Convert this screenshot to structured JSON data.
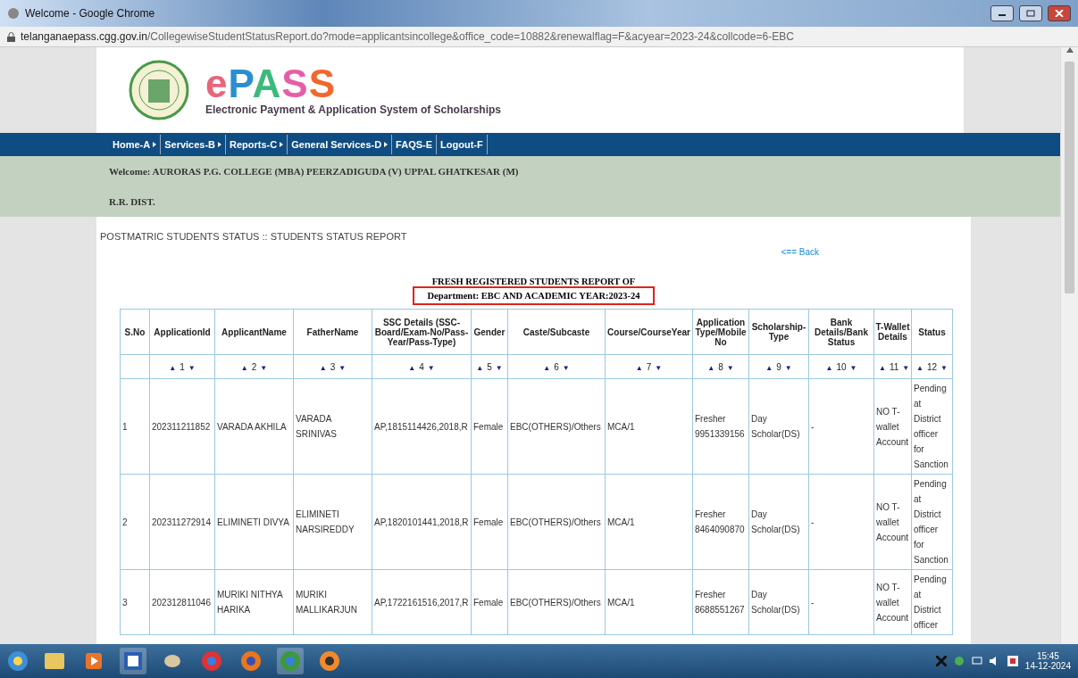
{
  "window": {
    "title": "Welcome - Google Chrome"
  },
  "address_bar": {
    "host": "telanganaepass.cgg.gov.in",
    "path": "/CollegewiseStudentStatusReport.do?mode=applicantsincollege&office_code=10882&renewalflag=F&acyear=2023-24&collcode=6-EBC"
  },
  "header": {
    "logo_text": "ePASS",
    "subtitle": "Electronic Payment & Application System of Scholarships"
  },
  "nav": [
    {
      "label": "Home-A",
      "arrow": true
    },
    {
      "label": "Services-B",
      "arrow": true
    },
    {
      "label": "Reports-C",
      "arrow": true
    },
    {
      "label": "General Services-D",
      "arrow": true
    },
    {
      "label": "FAQS-E",
      "arrow": false
    },
    {
      "label": "Logout-F",
      "arrow": false
    }
  ],
  "welcome": {
    "line1": "Welcome: AURORAS P.G. COLLEGE (MBA) PEERZADIGUDA (V) UPPAL GHATKESAR (M)",
    "line2": "R.R. DIST."
  },
  "page_heading": "POSTMATRIC STUDENTS STATUS :: STUDENTS STATUS REPORT",
  "back_link": "<== Back",
  "report_title": "FRESH REGISTERED STUDENTS REPORT OF",
  "report_subtitle": "Department: EBC AND ACADEMIC YEAR:2023-24",
  "table": {
    "columns": [
      "S.No",
      "ApplicationId",
      "ApplicantName",
      "FatherName",
      "SSC Details (SSC-Board/Exam-No/Pass-Year/Pass-Type)",
      "Gender",
      "Caste/Subcaste",
      "Course/CourseYear",
      "Application Type/Mobile No",
      "Scholarship-Type",
      "Bank Details/Bank Status",
      "T-Wallet Details",
      "Status"
    ],
    "sort_row": [
      {
        "up": "▲",
        "label": "1",
        "down": "▼"
      },
      {
        "up": "▲",
        "label": "2",
        "down": "▼"
      },
      {
        "up": "▲",
        "label": "3",
        "down": "▼"
      },
      {
        "up": "▲",
        "label": "4",
        "down": "▼"
      },
      {
        "up": "▲",
        "label": "5",
        "down": "▼"
      },
      {
        "up": "▲",
        "label": "6",
        "down": "▼"
      },
      {
        "up": "▲",
        "label": "7",
        "down": "▼"
      },
      {
        "up": "▲",
        "label": "8",
        "down": "▼"
      },
      {
        "up": "▲",
        "label": "9",
        "down": "▼"
      },
      {
        "up": "▲",
        "label": "10",
        "down": "▼"
      },
      {
        "up": "▲",
        "label": "11",
        "down": "▼"
      },
      {
        "up": "▲",
        "label": "12",
        "down": "▼"
      }
    ],
    "rows": [
      [
        "1",
        "202311211852",
        "VARADA AKHILA",
        "VARADA SRINIVAS",
        "AP,1815114426,2018,R",
        "Female",
        "EBC(OTHERS)/Others",
        "MCA/1",
        "Fresher 9951339156",
        "Day Scholar(DS)",
        "-",
        "NO T-wallet Account",
        "Pending at District officer for Sanction"
      ],
      [
        "2",
        "202311272914",
        "ELIMINETI DIVYA",
        "ELIMINETI NARSIREDDY",
        "AP,1820101441,2018,R",
        "Female",
        "EBC(OTHERS)/Others",
        "MCA/1",
        "Fresher 8464090870",
        "Day Scholar(DS)",
        "-",
        "NO T-wallet Account",
        "Pending at District officer for Sanction"
      ],
      [
        "3",
        "202312811046",
        "MURIKI NITHYA HARIKA",
        "MURIKI MALLIKARJUN",
        "AP,1722161516,2017,R",
        "Female",
        "EBC(OTHERS)/Others",
        "MCA/1",
        "Fresher 8688551267",
        "Day Scholar(DS)",
        "-",
        "NO T-wallet Account",
        "Pending at District officer"
      ]
    ]
  },
  "taskbar": {
    "time": "15:45",
    "date": "14-12-2024"
  }
}
